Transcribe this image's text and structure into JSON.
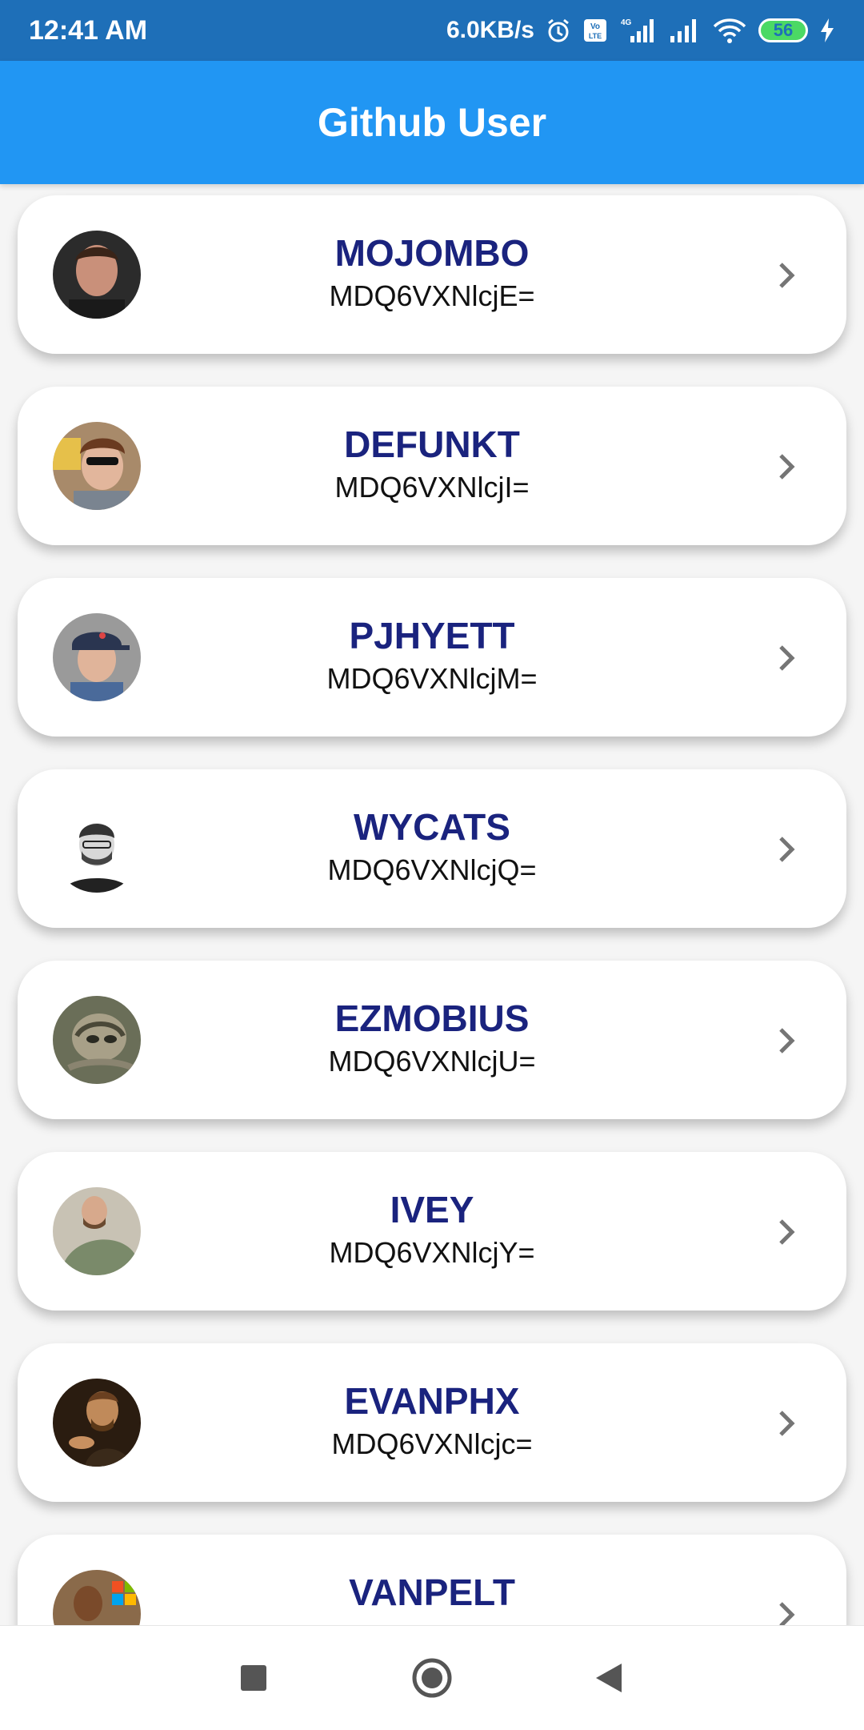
{
  "status_bar": {
    "time": "12:41 AM",
    "speed": "6.0KB/s",
    "battery": "56",
    "icons": [
      "alarm-icon",
      "volte-icon",
      "signal-4g-icon",
      "signal-icon",
      "wifi-icon",
      "battery-icon",
      "charging-icon"
    ]
  },
  "app_bar": {
    "title": "Github User"
  },
  "users": [
    {
      "name": "MOJOMBO",
      "id": "MDQ6VXNlcjE="
    },
    {
      "name": "DEFUNKT",
      "id": "MDQ6VXNlcjI="
    },
    {
      "name": "PJHYETT",
      "id": "MDQ6VXNlcjM="
    },
    {
      "name": "WYCATS",
      "id": "MDQ6VXNlcjQ="
    },
    {
      "name": "EZMOBIUS",
      "id": "MDQ6VXNlcjU="
    },
    {
      "name": "IVEY",
      "id": "MDQ6VXNlcjY="
    },
    {
      "name": "EVANPHX",
      "id": "MDQ6VXNlcjc="
    },
    {
      "name": "VANPELT",
      "id": ""
    }
  ],
  "colors": {
    "status_bar": "#1e6fb8",
    "app_bar": "#2196f3",
    "name_text": "#1a237e",
    "card_bg": "#ffffff",
    "page_bg": "#f5f5f5"
  },
  "nav_bar": {
    "icons": [
      "recents-square-icon",
      "home-circle-icon",
      "back-triangle-icon"
    ]
  }
}
